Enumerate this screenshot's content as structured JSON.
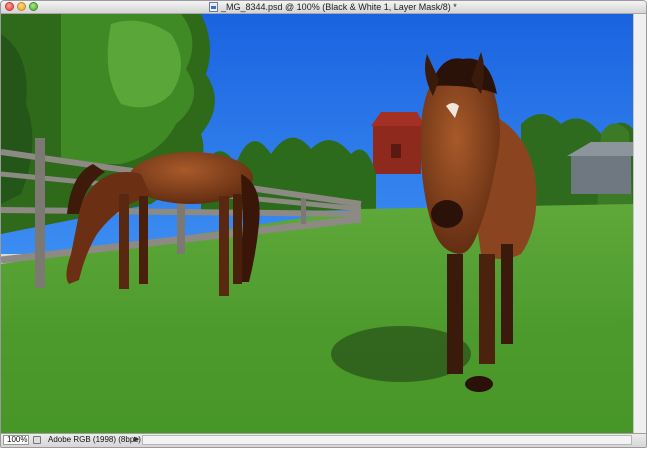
{
  "window": {
    "title": "_MG_8344.psd @ 100% (Black & White 1, Layer Mask/8) *"
  },
  "status_bar": {
    "zoom": "100%",
    "color_profile": "Adobe RGB (1998) (8bpc)",
    "menu_arrow": "▶"
  },
  "canvas": {
    "content": "photograph"
  },
  "colors": {
    "sky": "#1e6fe6",
    "grass": "#4a9a2c",
    "horse_brown": "#7a3a1a"
  }
}
